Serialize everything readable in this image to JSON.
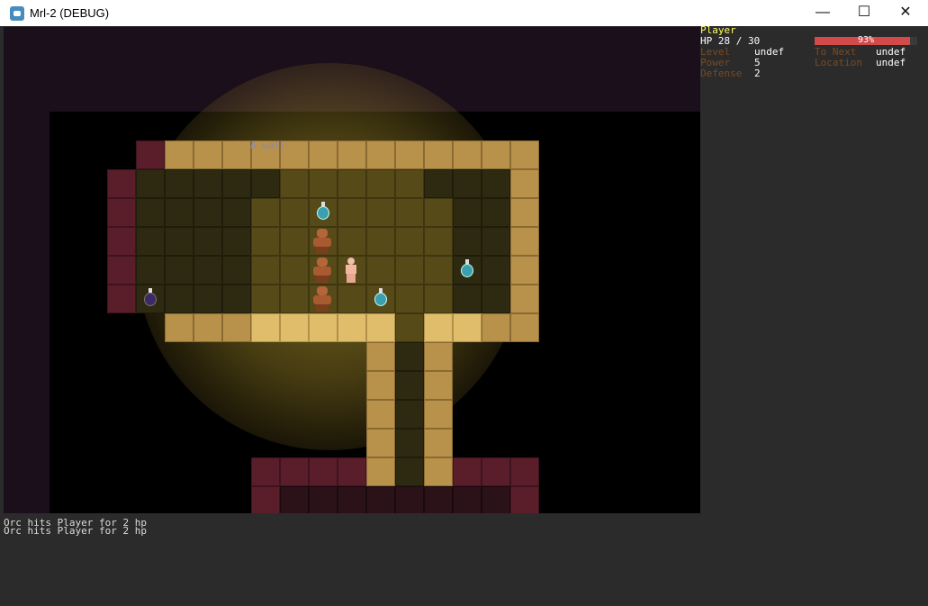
{
  "window": {
    "title": "Mrl-2 (DEBUG)"
  },
  "viewport": {
    "tooltip": "A wall"
  },
  "player": {
    "name": "Player",
    "hp_label": "HP",
    "hp_text": "28 / 30",
    "hp_fraction": 0.93,
    "hp_percent": "93%",
    "level_label": "Level",
    "level_value": "undef",
    "to_next_label": "To Next",
    "to_next_value": "undef",
    "power_label": "Power",
    "power_value": "5",
    "location_label": "Location",
    "location_value": "undef",
    "defense_label": "Defense",
    "defense_value": "2"
  },
  "log": {
    "messages": [
      "Orc hits Player for 2 hp",
      "Orc hits Player for 2 hp"
    ]
  },
  "colors": {
    "name": "#ffff66",
    "label": "#7a4a24",
    "hp_bar": "#d24a4a",
    "log_text": "#dcdcdc"
  }
}
